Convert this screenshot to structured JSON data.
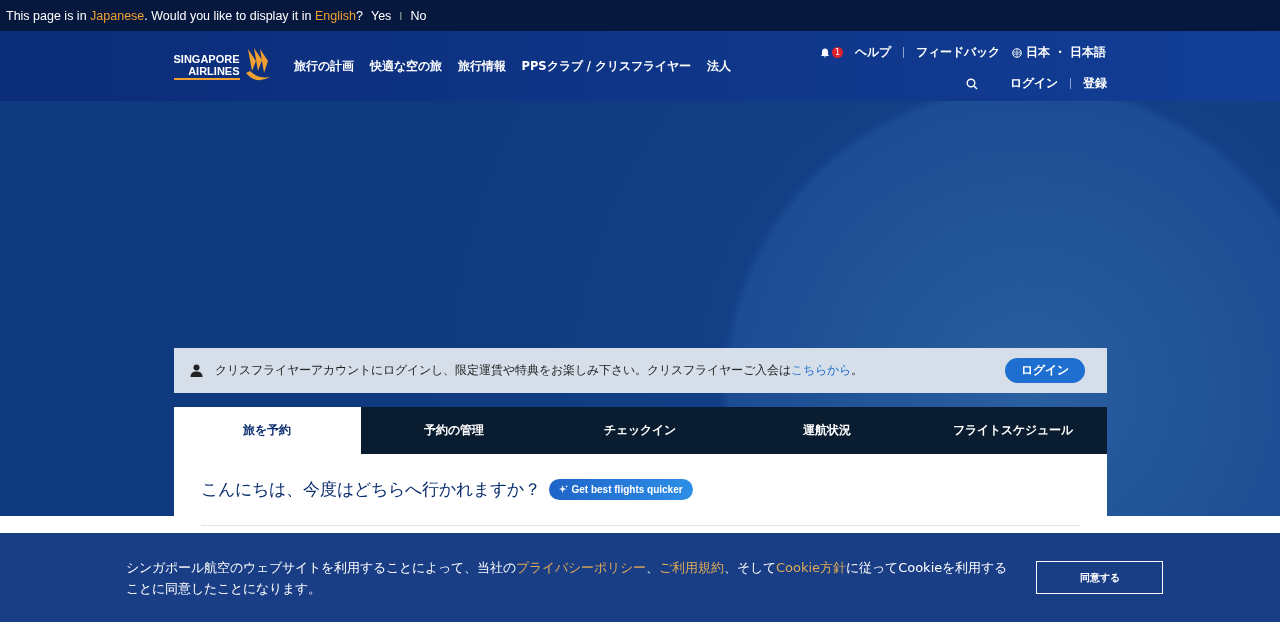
{
  "translate_bar": {
    "message": "This page is in **Japanese**. Would you like to display it in **English**?",
    "yes": "Yes",
    "separator": "I",
    "no": "No"
  },
  "header": {
    "logo_line1": "SINGAPORE",
    "logo_line2": "AIRLINES",
    "nav": [
      "旅行の計画",
      "快適な空の旅",
      "旅行情報",
      "PPSクラブ / クリスフライヤー",
      "法人"
    ],
    "utility": {
      "notification_count": "1",
      "help": "ヘルプ",
      "feedback": "フィードバック",
      "locale": "日本 ・ 日本語"
    },
    "login": "ログイン",
    "register": "登録"
  },
  "login_strip": {
    "message": "クリスフライヤーアカウントにログインし、限定運賃や特典をお楽しみ下さい。クリスフライヤーご入会は",
    "link": "こちらから",
    "after": "。",
    "button": "ログイン"
  },
  "tabs": [
    {
      "label": "旅を予約",
      "selected": true
    },
    {
      "label": "予約の管理",
      "selected": false
    },
    {
      "label": "チェックイン",
      "selected": false
    },
    {
      "label": "運航状況",
      "selected": false
    },
    {
      "label": "フライトスケジュール",
      "selected": false
    }
  ],
  "booking": {
    "greeting": "こんにちは、今度はどちらへ行かれますか？",
    "ai_button": "Get best flights quicker"
  },
  "cookie_banner": {
    "message": "シンガポール航空のウェブサイトを利用することによって、当社の",
    "links": [
      "プライバシーポリシー",
      "ご利用規約",
      "Cookie方針"
    ],
    "joiners": [
      "、",
      "、そして",
      "に従ってCookieを利用することに同意したことになります。"
    ],
    "button": "同意する"
  }
}
